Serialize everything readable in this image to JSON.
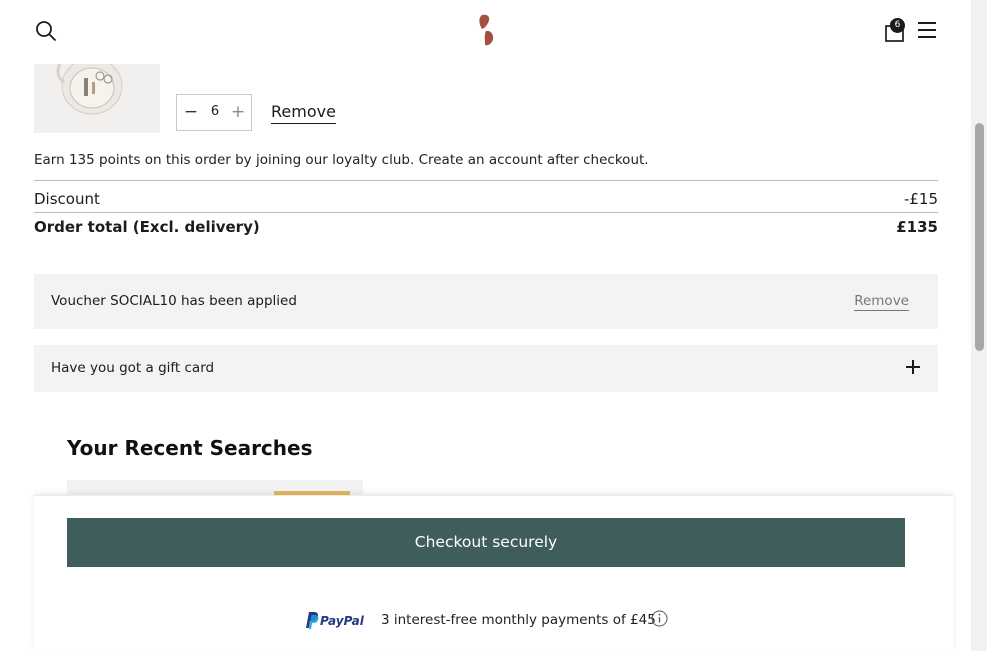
{
  "header": {
    "search_icon": "search-icon",
    "logo_icon": "brand-logo",
    "bag_icon": "shopping-bag-icon",
    "bag_count": "6",
    "menu_icon": "hamburger-menu-icon"
  },
  "cart_item": {
    "quantity": "6",
    "minus_label": "−",
    "plus_label": "+",
    "remove_label": "Remove"
  },
  "loyalty_message": "Earn 135 points on this order by joining our loyalty club. Create an account after checkout.",
  "summary": {
    "discount_label": "Discount",
    "discount_value": "-£15",
    "total_label": "Order total (Excl. delivery)",
    "total_value": "£135"
  },
  "voucher": {
    "message": "Voucher SOCIAL10 has been applied",
    "remove_label": "Remove"
  },
  "gift_card": {
    "label": "Have you got a gift card"
  },
  "recent_searches": {
    "title": "Your Recent Searches"
  },
  "checkout": {
    "button_label": "Checkout securely",
    "paypal_logo_text": "PayPal",
    "paypal_message": "3 interest-free monthly payments of £45"
  },
  "colors": {
    "checkout_button": "#3f5d5a",
    "panel_bg": "#f3f3f3",
    "logo": "#a4503f",
    "paypal_dark": "#253b80",
    "paypal_light": "#179bd7"
  }
}
